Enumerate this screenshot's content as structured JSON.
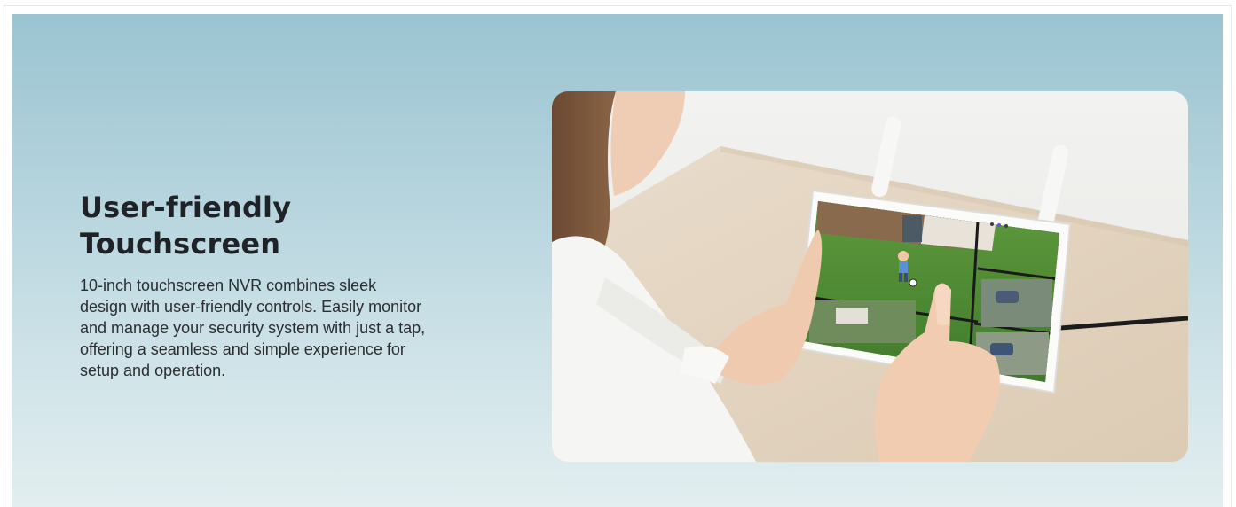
{
  "feature": {
    "title": "User-friendly Touchscreen",
    "description": "10-inch touchscreen NVR combines sleek design with user-friendly controls. Easily monitor and manage your security system with just a tap, offering a seamless and simple experience for setup and operation."
  },
  "image": {
    "subject": "tablet-nvr-photo"
  },
  "colors": {
    "gradient_top": "#9ac4d1",
    "gradient_bottom": "#e2eef0",
    "text": "#1f2226"
  }
}
